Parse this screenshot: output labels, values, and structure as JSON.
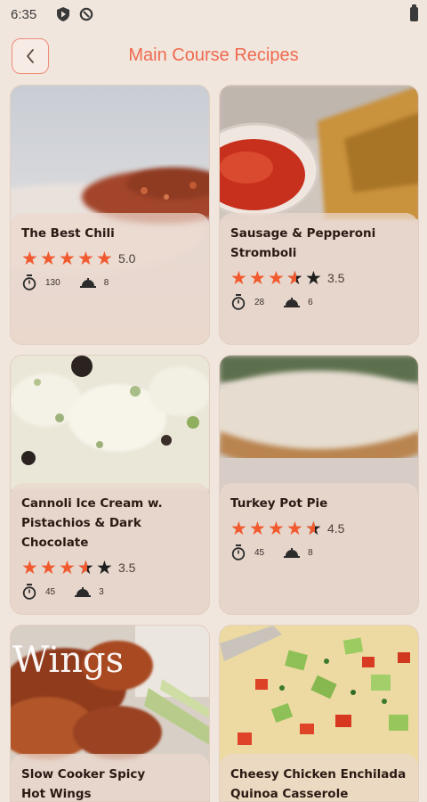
{
  "status_bar": {
    "time": "6:35"
  },
  "header": {
    "title": "Main Course Recipes"
  },
  "recipes": [
    {
      "name": "The Best Chili",
      "rating": 5.0,
      "rating_label": "5.0",
      "time": "130",
      "servings": "8"
    },
    {
      "name": "Sausage & Pepperoni Stromboli",
      "rating": 3.5,
      "rating_label": "3.5",
      "time": "28",
      "servings": "6"
    },
    {
      "name": "Cannoli Ice Cream w. Pistachios & Dark Chocolate",
      "rating": 3.5,
      "rating_label": "3.5",
      "time": "45",
      "servings": "3"
    },
    {
      "name": "Turkey Pot Pie",
      "rating": 4.5,
      "rating_label": "4.5",
      "time": "45",
      "servings": "8"
    },
    {
      "name": "Slow Cooker Spicy Hot Wings",
      "photo_text": "Wings"
    },
    {
      "name": "Cheesy Chicken Enchilada Quinoa Casserole"
    }
  ],
  "colors": {
    "accent": "#ef6a4f",
    "star": "#f1592e",
    "background": "#f1e6dd"
  }
}
